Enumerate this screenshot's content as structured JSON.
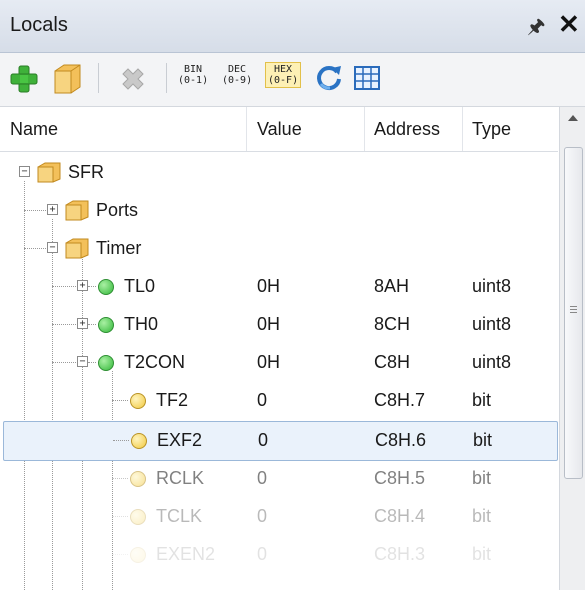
{
  "panel": {
    "title": "Locals",
    "pin_icon": "pin-icon",
    "close_icon": "close-icon"
  },
  "toolbar": {
    "buttons": [
      "add-icon",
      "folder-icon",
      "delete-icon"
    ],
    "formats": [
      {
        "top": "BIN",
        "bottom": "(0-1)"
      },
      {
        "top": "DEC",
        "bottom": "(0-9)"
      },
      {
        "top": "HEX",
        "bottom": "(0-F)"
      }
    ],
    "active_format": "HEX",
    "tools": [
      "refresh-icon",
      "grid-icon"
    ]
  },
  "columns": [
    "Name",
    "Value",
    "Address",
    "Type"
  ],
  "tree": [
    {
      "name": "SFR",
      "value": "",
      "address": "",
      "type": ""
    },
    {
      "name": "Ports",
      "value": "",
      "address": "",
      "type": ""
    },
    {
      "name": "Timer",
      "value": "",
      "address": "",
      "type": ""
    },
    {
      "name": "TL0",
      "value": "0H",
      "address": "8AH",
      "type": "uint8"
    },
    {
      "name": "TH0",
      "value": "0H",
      "address": "8CH",
      "type": "uint8"
    },
    {
      "name": "T2CON",
      "value": "0H",
      "address": "C8H",
      "type": "uint8"
    },
    {
      "name": "TF2",
      "value": "0",
      "address": "C8H.7",
      "type": "bit"
    },
    {
      "name": "EXF2",
      "value": "0",
      "address": "C8H.6",
      "type": "bit"
    },
    {
      "name": "RCLK",
      "value": "0",
      "address": "C8H.5",
      "type": "bit"
    },
    {
      "name": "TCLK",
      "value": "0",
      "address": "C8H.4",
      "type": "bit"
    },
    {
      "name": "EXEN2",
      "value": "0",
      "address": "C8H.3",
      "type": "bit"
    }
  ],
  "selected_row": "EXF2",
  "colors": {
    "selection_bg": "#eaf2fb",
    "selection_border": "#9bb8d9",
    "accent_hex": "#fdf0b5"
  }
}
